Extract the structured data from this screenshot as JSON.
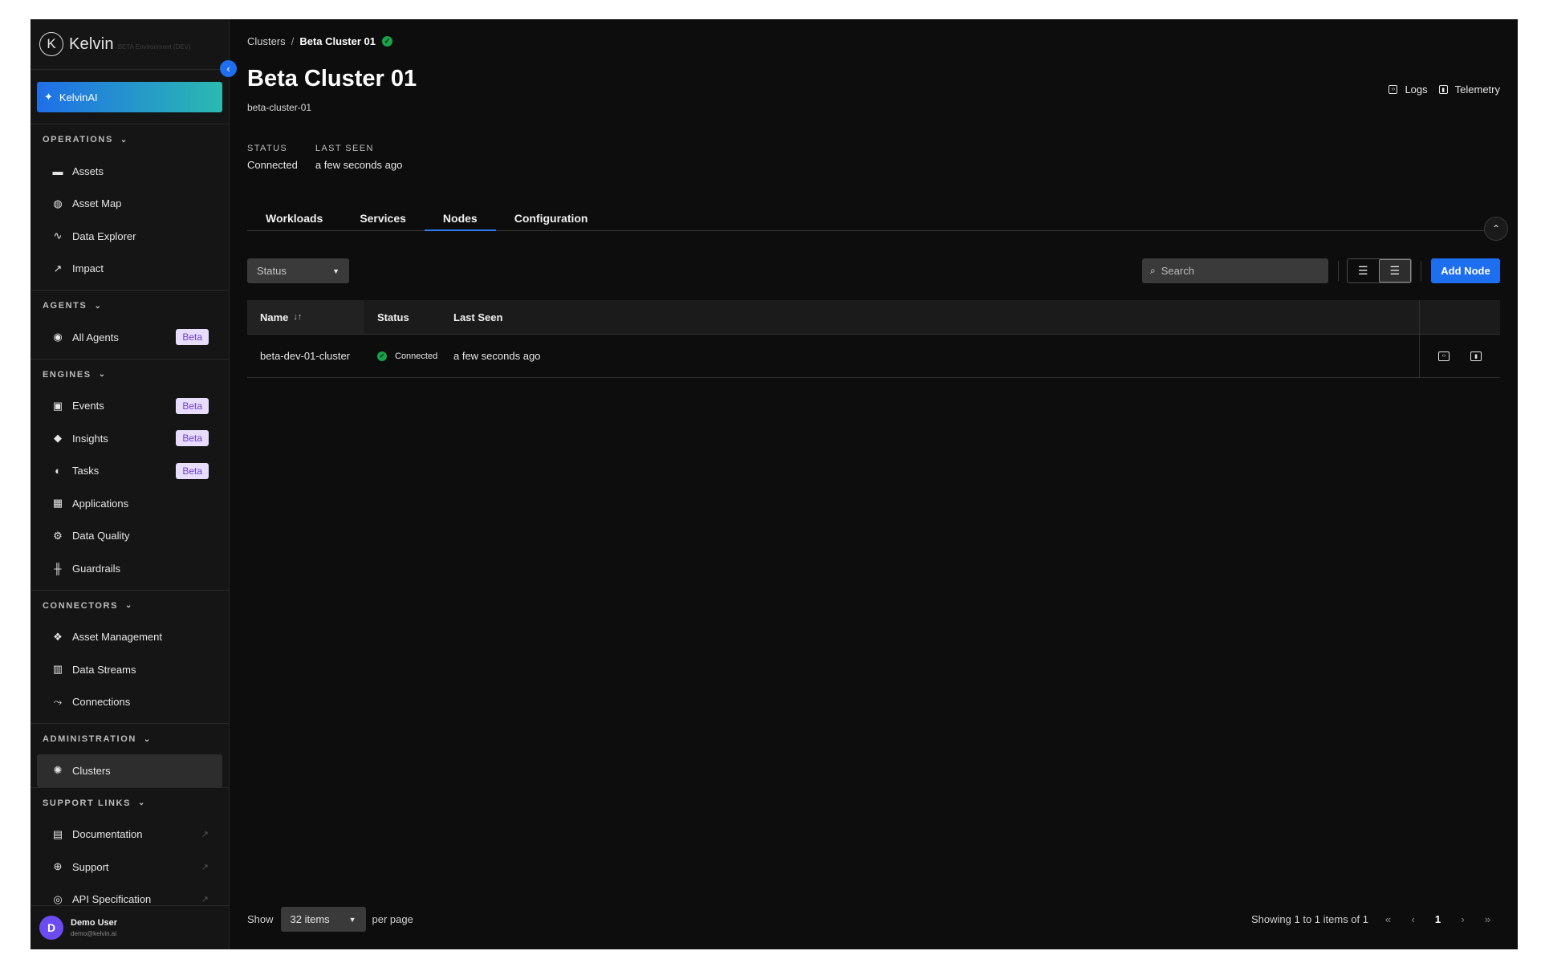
{
  "sidebar": {
    "brand": "Kelvin",
    "brand_mark": "K",
    "environment": "BETA Environment (DEV)",
    "ai_button": "KelvinAI",
    "sections": {
      "operations": {
        "title": "OPERATIONS",
        "items": [
          {
            "label": "Assets",
            "icon": "assets-icon"
          },
          {
            "label": "Asset Map",
            "icon": "globe-icon"
          },
          {
            "label": "Data Explorer",
            "icon": "pulse-icon"
          },
          {
            "label": "Impact",
            "icon": "trend-icon"
          }
        ]
      },
      "agents": {
        "title": "AGENTS",
        "items": [
          {
            "label": "All Agents",
            "icon": "agent-icon",
            "badge": "Beta"
          }
        ]
      },
      "engines": {
        "title": "ENGINES",
        "items": [
          {
            "label": "Events",
            "icon": "events-icon",
            "badge": "Beta"
          },
          {
            "label": "Insights",
            "icon": "tag-icon",
            "badge": "Beta"
          },
          {
            "label": "Tasks",
            "icon": "tasks-icon",
            "badge": "Beta"
          },
          {
            "label": "Applications",
            "icon": "apps-icon"
          },
          {
            "label": "Data Quality",
            "icon": "gear-icon"
          },
          {
            "label": "Guardrails",
            "icon": "guardrail-icon"
          }
        ]
      },
      "connectors": {
        "title": "CONNECTORS",
        "items": [
          {
            "label": "Asset Management",
            "icon": "asset-management-icon"
          },
          {
            "label": "Data Streams",
            "icon": "bar-chart-icon"
          },
          {
            "label": "Connections",
            "icon": "connections-icon"
          }
        ]
      },
      "administration": {
        "title": "ADMINISTRATION",
        "items": [
          {
            "label": "Clusters",
            "icon": "cluster-icon",
            "active": true
          }
        ]
      },
      "support": {
        "title": "SUPPORT LINKS",
        "items": [
          {
            "label": "Documentation",
            "icon": "doc-icon"
          },
          {
            "label": "Support",
            "icon": "lifebuoy-icon"
          },
          {
            "label": "API Specification",
            "icon": "api-icon"
          }
        ]
      }
    },
    "user": {
      "initial": "D",
      "name": "Demo User",
      "email": "demo@kelvin.ai"
    }
  },
  "header": {
    "breadcrumb_root": "Clusters",
    "breadcrumb_sep": "/",
    "breadcrumb_current": "Beta Cluster 01",
    "title": "Beta Cluster 01",
    "subtitle": "beta-cluster-01",
    "logs_label": "Logs",
    "telemetry_label": "Telemetry",
    "status_label": "STATUS",
    "status_value": "Connected",
    "last_seen_label": "LAST SEEN",
    "last_seen_value": "a few seconds ago"
  },
  "tabs": [
    {
      "label": "Workloads"
    },
    {
      "label": "Services"
    },
    {
      "label": "Nodes",
      "active": true
    },
    {
      "label": "Configuration"
    }
  ],
  "toolbar": {
    "status_filter": "Status",
    "search_placeholder": "Search",
    "add_button": "Add Node"
  },
  "table": {
    "columns": {
      "name": "Name",
      "status": "Status",
      "last_seen": "Last Seen"
    },
    "rows": [
      {
        "name": "beta-dev-01-cluster",
        "status": "Connected",
        "last_seen": "a few seconds ago"
      }
    ]
  },
  "footer": {
    "show_label": "Show",
    "per_page_value": "32 items",
    "per_page_label": "per page",
    "showing_text": "Showing 1 to 1 items of 1",
    "current_page": "1"
  },
  "colors": {
    "accent": "#1e6ef0",
    "success": "#17a34a",
    "badge_bg": "#e8ddff",
    "badge_text": "#6a3fd6"
  }
}
